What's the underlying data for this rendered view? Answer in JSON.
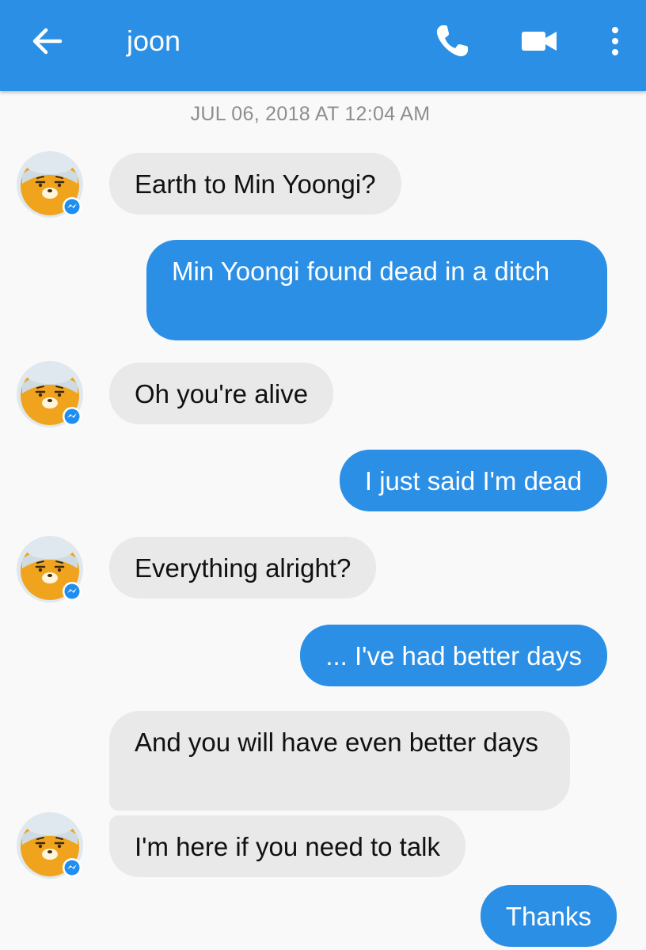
{
  "header": {
    "contact_name": "joon",
    "back_icon": "arrow-left-icon",
    "call_icon": "phone-icon",
    "video_icon": "video-camera-icon",
    "more_icon": "more-vertical-icon",
    "bar_color": "#2b8fe6"
  },
  "conversation": {
    "timestamp": "JUL 06, 2018 AT 12:04 AM",
    "messages": [
      {
        "sender": "joon",
        "text": "Earth to Min Yoongi?"
      },
      {
        "sender": "me",
        "text": "Min Yoongi found dead in a ditch"
      },
      {
        "sender": "joon",
        "text": "Oh you're alive"
      },
      {
        "sender": "me",
        "text": "I just said I'm dead"
      },
      {
        "sender": "joon",
        "text": "Everything alright?"
      },
      {
        "sender": "me",
        "text": "... I've had better days"
      },
      {
        "sender": "joon",
        "text": "And you will have even better days"
      },
      {
        "sender": "joon",
        "text": "I'm here if you need to talk"
      },
      {
        "sender": "me",
        "text": "Thanks"
      }
    ],
    "incoming_bubble_color": "#e9e9e9",
    "outgoing_bubble_color": "#2b8fe6",
    "avatar_icon": "ryan-bear-avatar",
    "badge_icon": "messenger-badge-icon"
  }
}
